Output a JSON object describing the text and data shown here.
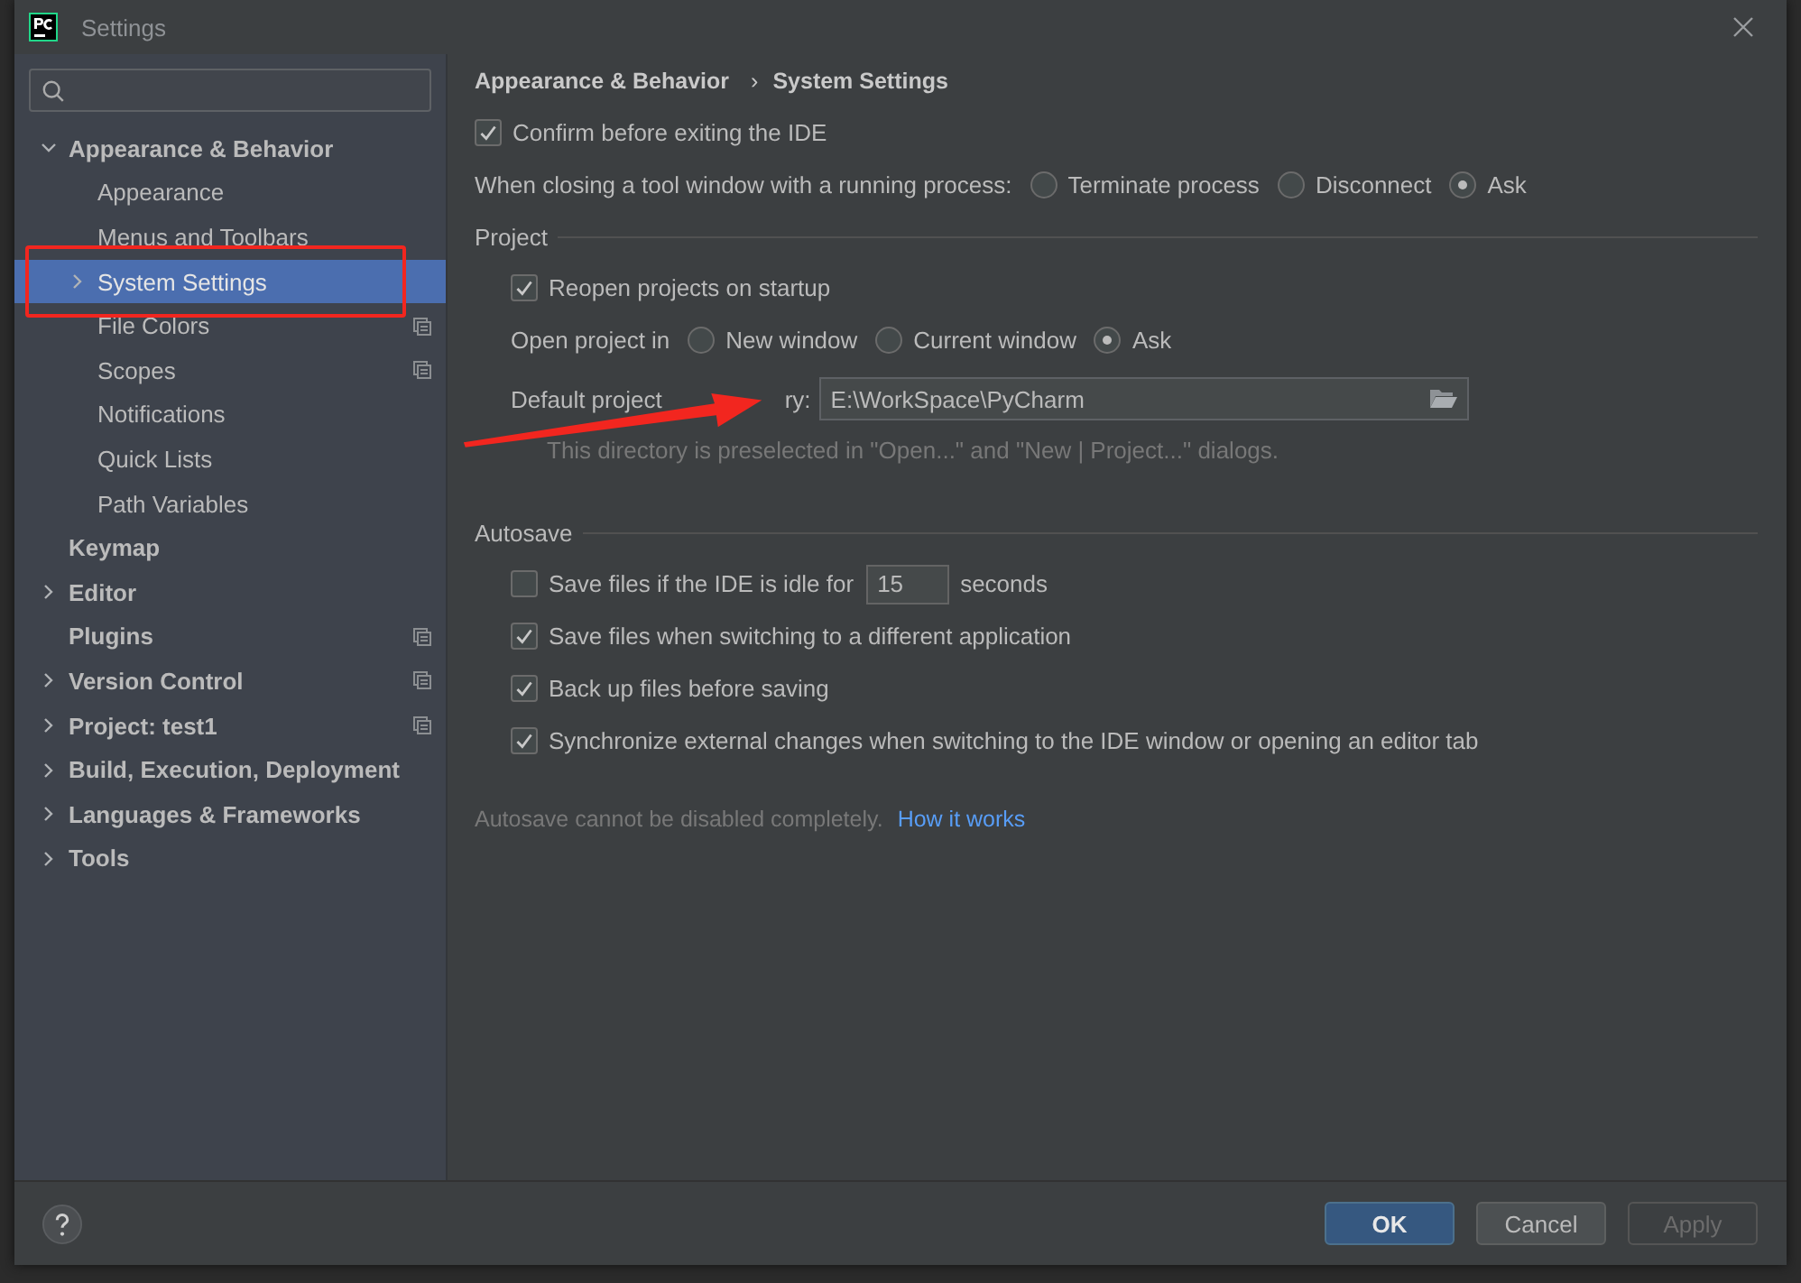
{
  "window": {
    "title": "Settings"
  },
  "sidebar": {
    "items": [
      {
        "label": "Appearance & Behavior",
        "expanded": true,
        "selected": false,
        "shared": false,
        "children": [
          {
            "label": "Appearance",
            "selected": false,
            "shared": false
          },
          {
            "label": "Menus and Toolbars",
            "selected": false,
            "shared": false
          },
          {
            "label": "System Settings",
            "expanded": false,
            "selected": true,
            "shared": false
          },
          {
            "label": "File Colors",
            "selected": false,
            "shared": true
          },
          {
            "label": "Scopes",
            "selected": false,
            "shared": true
          },
          {
            "label": "Notifications",
            "selected": false,
            "shared": false
          },
          {
            "label": "Quick Lists",
            "selected": false,
            "shared": false
          },
          {
            "label": "Path Variables",
            "selected": false,
            "shared": false
          }
        ]
      },
      {
        "label": "Keymap",
        "selected": false,
        "shared": false
      },
      {
        "label": "Editor",
        "expanded": false,
        "selected": false,
        "shared": false
      },
      {
        "label": "Plugins",
        "selected": false,
        "shared": true
      },
      {
        "label": "Version Control",
        "expanded": false,
        "selected": false,
        "shared": true
      },
      {
        "label": "Project: test1",
        "expanded": false,
        "selected": false,
        "shared": true
      },
      {
        "label": "Build, Execution, Deployment",
        "expanded": false,
        "selected": false,
        "shared": false
      },
      {
        "label": "Languages & Frameworks",
        "expanded": false,
        "selected": false,
        "shared": false
      },
      {
        "label": "Tools",
        "expanded": false,
        "selected": false,
        "shared": false
      }
    ]
  },
  "content": {
    "breadcrumb": [
      "Appearance & Behavior",
      "System Settings"
    ],
    "breadcrumb_separator": "›",
    "rows": [
      {
        "kind": "checkbox",
        "label": "Confirm before exiting the IDE",
        "checked": true
      },
      {
        "kind": "radio",
        "label": "When closing a tool window with a running process:",
        "options": [
          {
            "label": "Terminate process",
            "selected": false
          },
          {
            "label": "Disconnect",
            "selected": false
          },
          {
            "label": "Ask",
            "selected": true
          }
        ]
      }
    ],
    "groups": [
      {
        "title": "Project",
        "rows": [
          {
            "kind": "checkbox",
            "label": "Reopen projects on startup",
            "checked": true
          },
          {
            "kind": "radio",
            "label": "Open project in",
            "options": [
              {
                "label": "New window",
                "selected": false
              },
              {
                "label": "Current window",
                "selected": false
              },
              {
                "label": "Ask",
                "selected": true
              }
            ]
          },
          {
            "kind": "path",
            "label": "Default project",
            "label_end": "ry:",
            "value": "E:\\WorkSpace\\PyCharm"
          },
          {
            "kind": "hint",
            "label": "This directory is preselected in \"Open...\" and \"New | Project...\" dialogs."
          }
        ]
      },
      {
        "title": "Autosave",
        "rows": [
          {
            "kind": "idle",
            "label": "Save files if the IDE is idle for",
            "checked": false,
            "value": "15",
            "suffix": "seconds"
          },
          {
            "kind": "checkbox",
            "label": "Save files when switching to a different application",
            "checked": true
          },
          {
            "kind": "checkbox",
            "label": "Back up files before saving",
            "checked": true
          },
          {
            "kind": "checkbox",
            "label": "Synchronize external changes when switching to the IDE window or opening an editor tab",
            "checked": true
          }
        ]
      }
    ],
    "note": {
      "text": "Autosave cannot be disabled completely.",
      "link": "How it works"
    }
  },
  "buttons": [
    {
      "label": "OK",
      "kind": "default",
      "disabled": false
    },
    {
      "label": "Cancel",
      "kind": "normal",
      "disabled": false
    },
    {
      "label": "Apply",
      "kind": "normal",
      "disabled": true
    }
  ]
}
